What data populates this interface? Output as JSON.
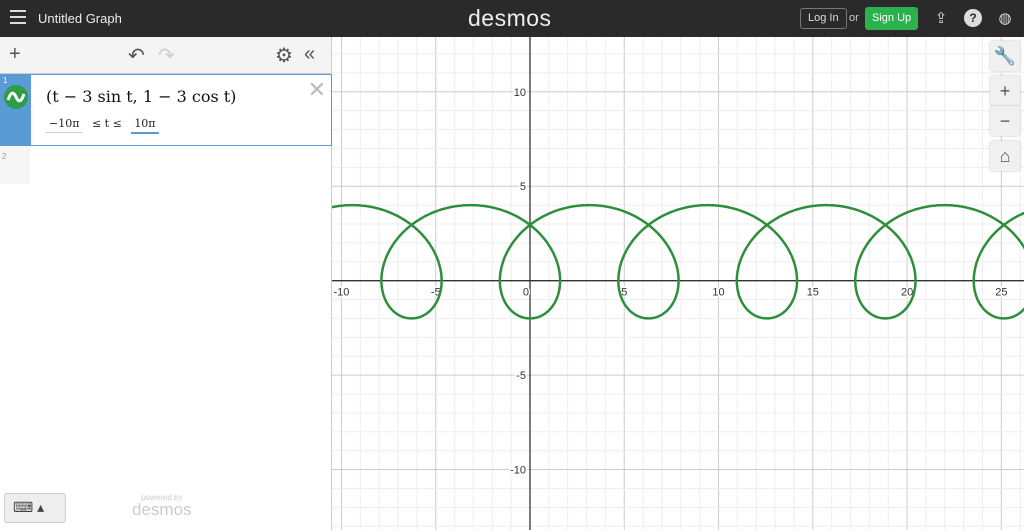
{
  "header": {
    "title": "Untitled Graph",
    "logo": "desmos",
    "login": "Log In",
    "or": "or",
    "signup": "Sign Up",
    "icons": [
      "share-icon",
      "help-icon",
      "globe-icon"
    ]
  },
  "toolbar": {
    "add": "+",
    "undo": "↶",
    "redo": "↷",
    "settings": "⚙",
    "collapse": "«"
  },
  "expressions": [
    {
      "index": "1",
      "latex": "(t − 3 sin t, 1 − 3 cos t)",
      "tmin": "−10π",
      "le1": "≤ t ≤",
      "tmax": "10π",
      "color": "#2d8f3c"
    },
    {
      "index": "2"
    }
  ],
  "footer": {
    "keyboard": "⌨ ▴",
    "powered": "powered by",
    "brand": "desmos"
  },
  "graph_controls": {
    "wrench": "🔧",
    "zoom_in": "+",
    "zoom_out": "−",
    "home": "⌂"
  },
  "chart_data": {
    "type": "line",
    "parametric": {
      "x": "t - 3*sin(t)",
      "y": "1 - 3*cos(t)",
      "t_range": [
        -31.4159,
        31.4159
      ]
    },
    "xlim": [
      -10.5,
      26.2
    ],
    "ylim": [
      -13.2,
      12.9
    ],
    "x_ticks": [
      -10,
      -5,
      0,
      5,
      10,
      15,
      20,
      25
    ],
    "y_ticks": [
      10,
      5,
      -5,
      -10
    ],
    "grid": true
  }
}
